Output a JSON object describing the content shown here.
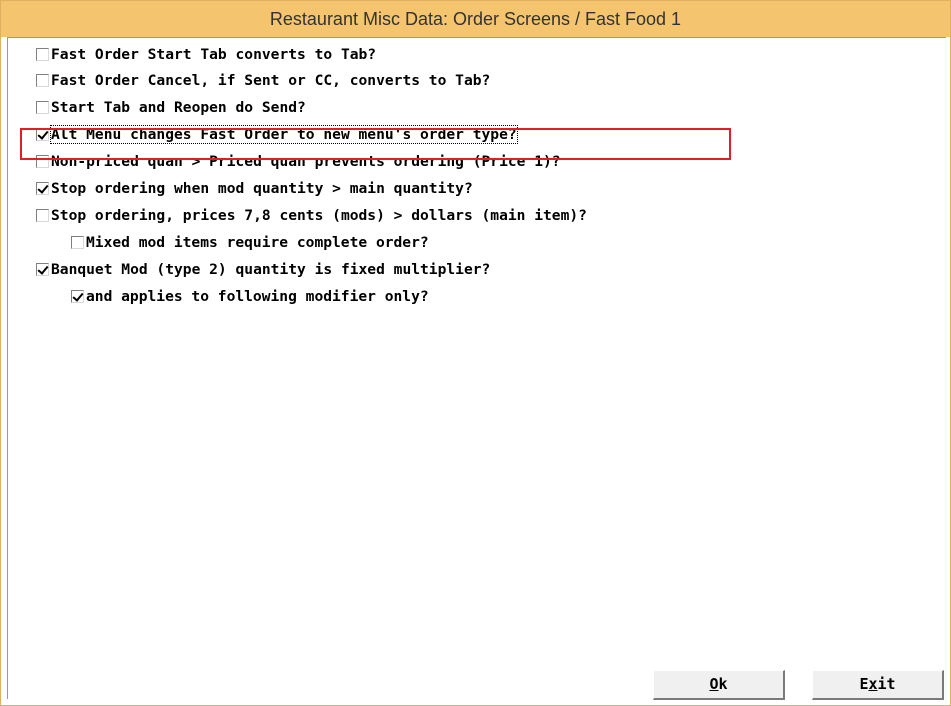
{
  "window": {
    "title": "Restaurant Misc Data:  Order Screens / Fast Food 1"
  },
  "options": [
    {
      "label": "Fast Order Start Tab converts to Tab?",
      "checked": false
    },
    {
      "label": "Fast Order Cancel, if Sent or CC, converts to Tab?",
      "checked": false
    },
    {
      "label": "Start Tab and Reopen do Send?",
      "checked": false
    },
    {
      "label": "Alt Menu changes Fast Order to new menu's order type?",
      "checked": true
    },
    {
      "label": "Non-priced quan > Priced quan prevents ordering (Price 1)?",
      "checked": false
    },
    {
      "label": "Stop ordering when mod quantity > main quantity?",
      "checked": true
    },
    {
      "label": "Stop ordering, prices 7,8 cents (mods) > dollars (main item)?",
      "checked": false
    },
    {
      "label": "Mixed mod items require complete order?",
      "checked": false
    },
    {
      "label": "Banquet Mod (type 2) quantity is fixed multiplier?",
      "checked": true
    },
    {
      "label": "and applies to following modifier only?",
      "checked": true
    }
  ],
  "buttons": {
    "ok": {
      "mnemonic": "O",
      "rest": "k"
    },
    "exit": {
      "pre": "E",
      "mnemonic": "x",
      "rest": "it"
    }
  },
  "colors": {
    "titlebar": "#f4c46e",
    "highlight_border": "#e02020"
  }
}
